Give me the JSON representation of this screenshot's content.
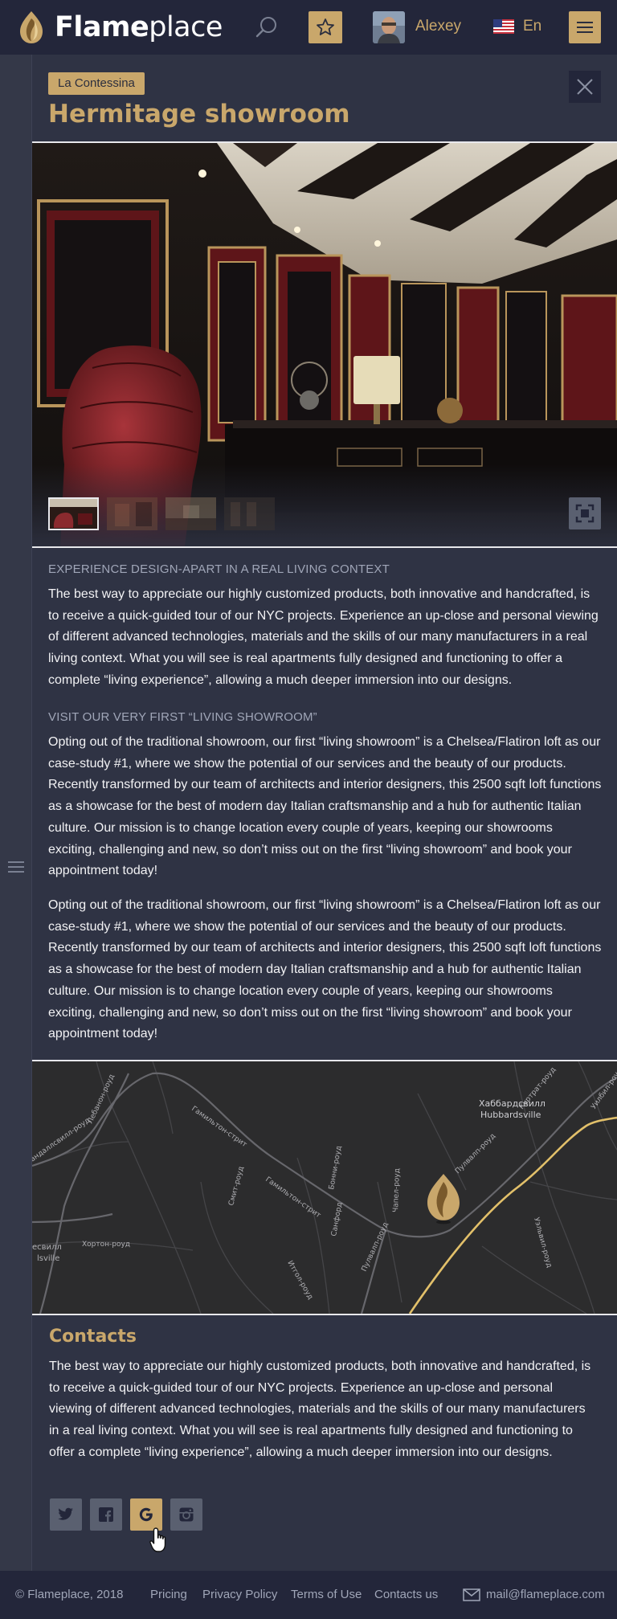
{
  "header": {
    "brand_bold": "Flame",
    "brand_light": "place",
    "user_name": "Alexey",
    "language": "En"
  },
  "showroom": {
    "tag": "La Contessina",
    "title": "Hermitage showroom"
  },
  "sections": [
    {
      "heading": "EXPERIENCE DESIGN-APART IN A REAL LIVING CONTEXT",
      "text": "The best way to appreciate our highly customized products, both innovative and handcrafted, is to receive a quick-guided tour of our NYC projects. Experience an up-close and personal viewing of different advanced technologies, materials and the skills of our many manufacturers in a real living context. What you will see is real apartments fully designed and functioning to offer a complete “living experience”, allowing a much deeper immersion into our designs."
    },
    {
      "heading": "VISIT OUR VERY FIRST “LIVING SHOWROOM”",
      "text": "Opting out of the traditional showroom, our first “living showroom” is a Chelsea/Flatiron loft as our case-study #1, where we show the potential of our services and the beauty of our products. Recently transformed by our team of architects and interior designers, this 2500 sqft loft functions as a showcase for the best of modern day Italian craftsmanship and a hub for authentic Italian culture. Our mission is to change location every couple of years, keeping our showrooms exciting, challenging and new, so don’t miss out on the first “living showroom” and book your appointment today!",
      "text2": "Opting out of the traditional showroom, our first “living showroom” is a Chelsea/Flatiron loft as our case-study #1, where we show the potential of our services and the beauty of our products. Recently transformed by our team of architects and interior designers, this 2500 sqft loft functions as a showcase for the best of modern day Italian craftsmanship and a hub for authentic Italian culture. Our mission is to change location every couple of years, keeping our showrooms exciting, challenging and new, so don’t miss out on the first “living showroom” and book your appointment today!"
    }
  ],
  "map": {
    "labels": {
      "hamilton1": "Гамильтон-стрит",
      "hamilton2": "Гамильтон-стрит",
      "lebanon": "Лебанон-роуд",
      "andallsville": "андаллсвилл-роуд",
      "hubbard_ru": "Хаббардсвилл",
      "hubbard_en": "Hubbardsville",
      "pulvalp1": "Пулвалп-роуд",
      "pulvalp2": "Пулвалп-роуд",
      "kurgrat": "Куртрат-роуд",
      "smith": "Смит-роуд",
      "bonny": "Бонни-роуд",
      "chapel": "Чапел-роуд",
      "sanfer": "Санфорд",
      "hortop": "Хортон-роуд",
      "esville": "есвилл",
      "lsville": "lsville",
      "ilgo": "Итгол-роуд",
      "ulevil": "Уэльвил-роуд",
      "bill": "Уилбил-роуд"
    }
  },
  "contacts": {
    "title": "Contacts",
    "text": "The best way to appreciate our highly customized products, both innovative and handcrafted, is to receive a quick-guided tour of our NYC projects. Experience an up-close and personal viewing of different advanced technologies, materials and the skills of our many manufacturers in a real living context. What you will see is real apartments fully designed and functioning to offer a complete “living experience”, allowing a much deeper immersion into our designs.",
    "socials": [
      "twitter-icon",
      "facebook-icon",
      "google-icon",
      "instagram-icon"
    ]
  },
  "footer": {
    "copyright": "© Flameplace, 2018",
    "links": [
      "Pricing",
      "Privacy Policy",
      "Terms of Use",
      "Contacts us"
    ],
    "email": "mail@flameplace.com"
  },
  "colors": {
    "accent": "#c9a76b",
    "background": "#2b2e3e",
    "header": "#23263a"
  }
}
